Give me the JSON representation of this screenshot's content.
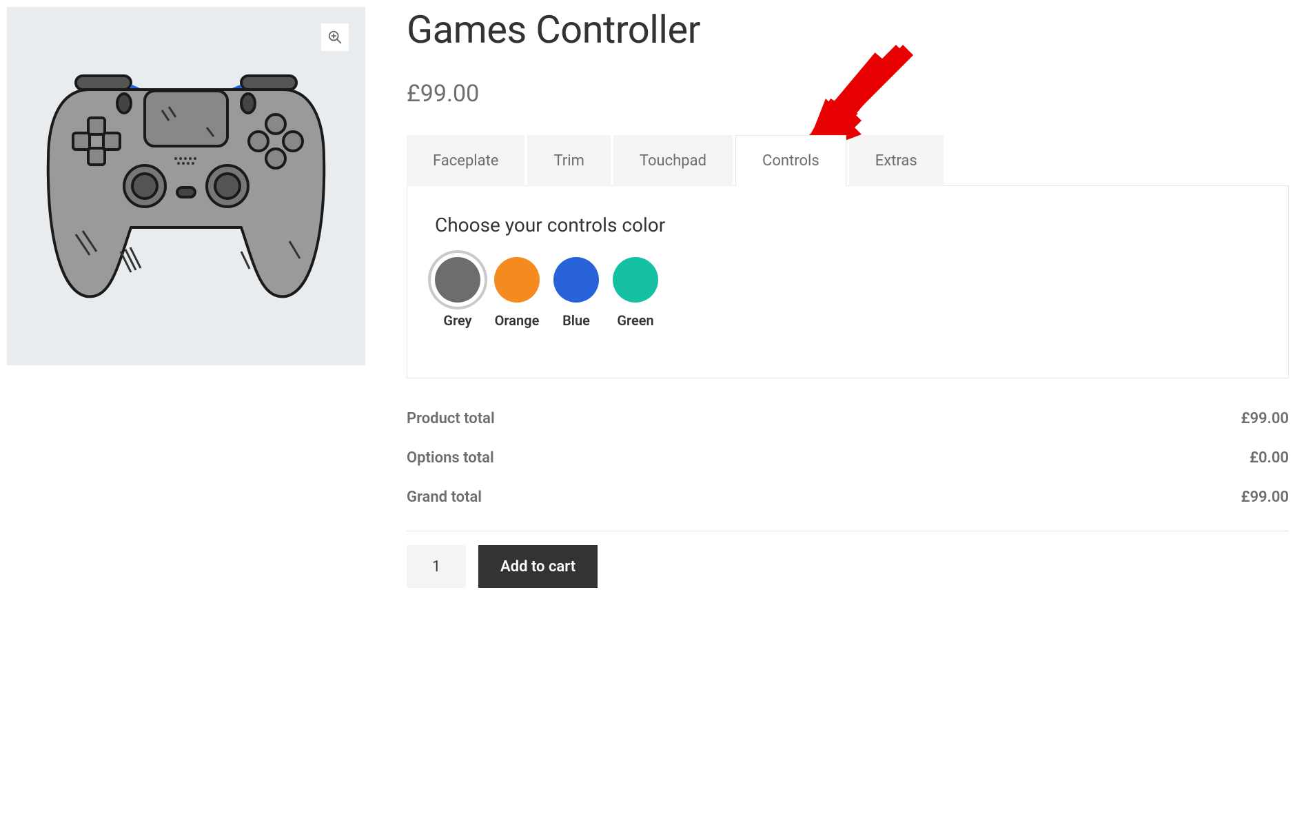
{
  "product": {
    "title": "Games Controller",
    "price": "£99.00"
  },
  "tabs": [
    {
      "label": "Faceplate",
      "active": false
    },
    {
      "label": "Trim",
      "active": false
    },
    {
      "label": "Touchpad",
      "active": false
    },
    {
      "label": "Controls",
      "active": true
    },
    {
      "label": "Extras",
      "active": false
    }
  ],
  "panel": {
    "title": "Choose your controls color",
    "swatches": [
      {
        "label": "Grey",
        "color": "#6d6d6d",
        "class": "swatch-grey",
        "selected": true
      },
      {
        "label": "Orange",
        "color": "#f58a1f",
        "class": "swatch-orange",
        "selected": false
      },
      {
        "label": "Blue",
        "color": "#2862d9",
        "class": "swatch-blue",
        "selected": false
      },
      {
        "label": "Green",
        "color": "#14c2a3",
        "class": "swatch-green",
        "selected": false
      }
    ]
  },
  "totals": {
    "product_label": "Product total",
    "product_value": "£99.00",
    "options_label": "Options total",
    "options_value": "£0.00",
    "grand_label": "Grand total",
    "grand_value": "£99.00"
  },
  "cart": {
    "quantity": "1",
    "add_label": "Add to cart"
  }
}
